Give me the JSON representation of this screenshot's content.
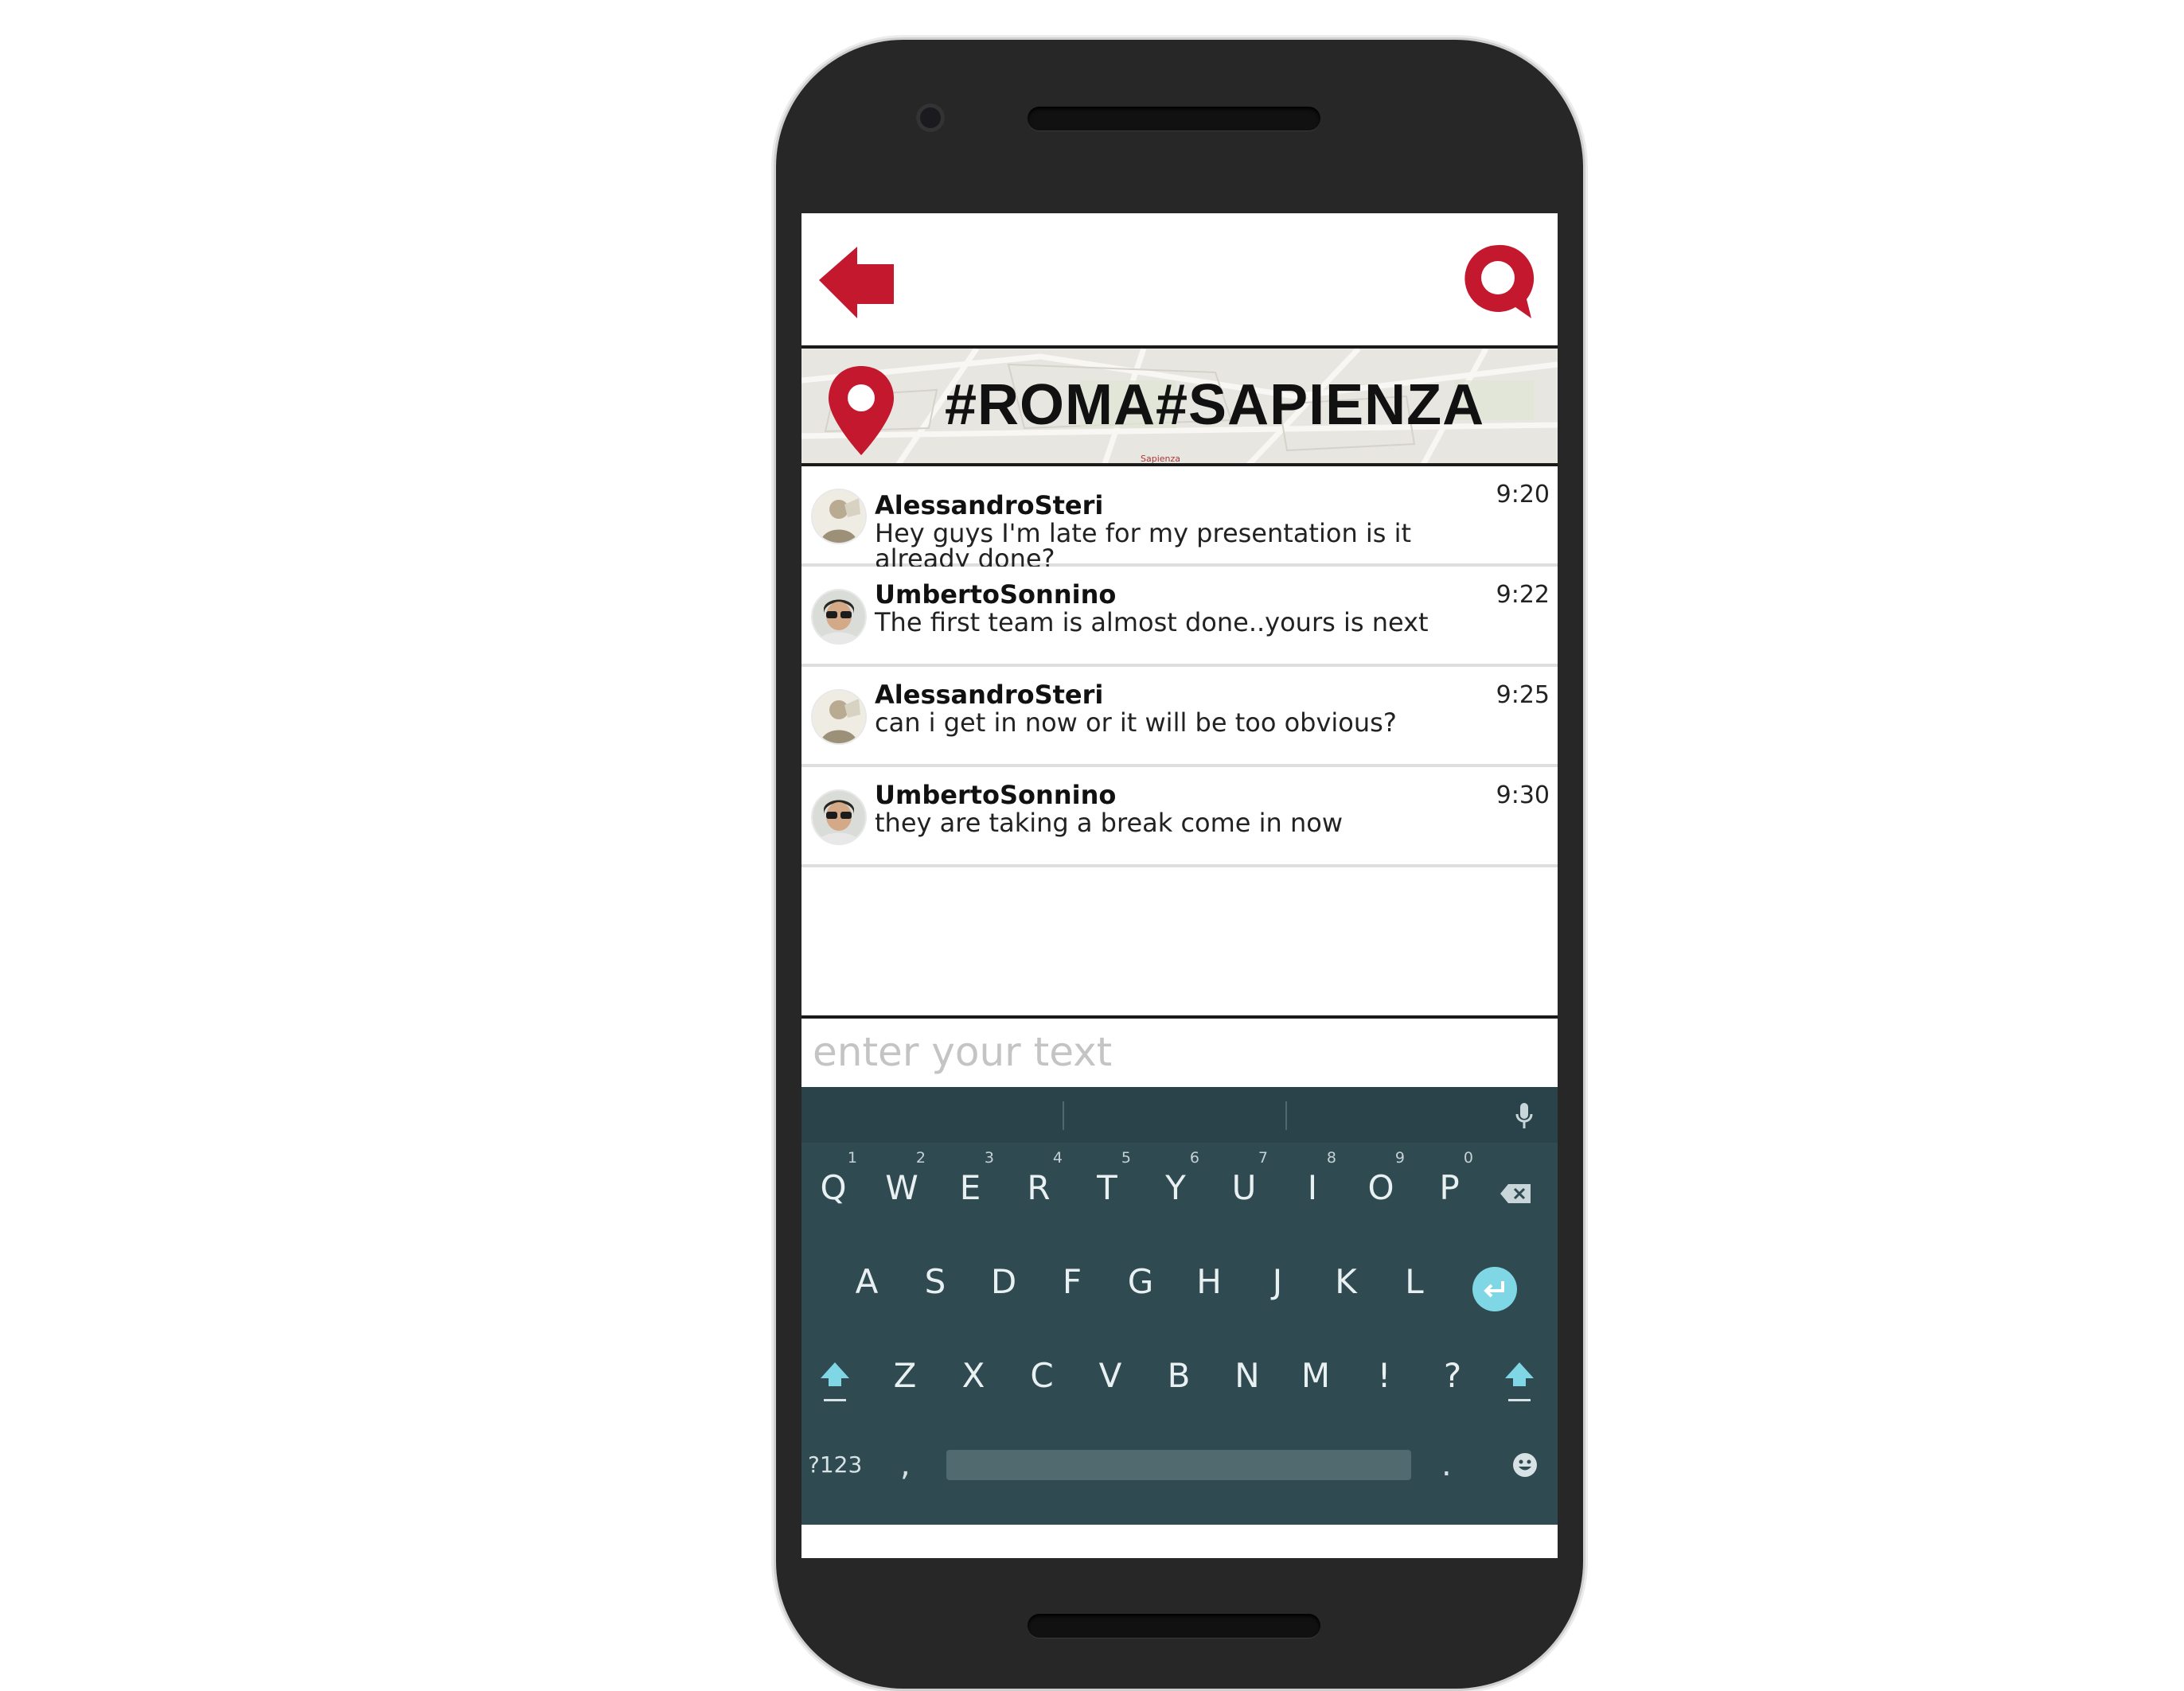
{
  "header": {
    "back_icon": "back-arrow-icon",
    "chat_icon": "chat-bubble-icon",
    "accent_color": "#c4182f"
  },
  "banner": {
    "pin_icon": "location-pin-icon",
    "title": "#ROMA#SAPIENZA",
    "map_label": "Sapienza"
  },
  "messages": [
    {
      "sender": "AlessandroSteri",
      "text": "Hey guys I'm late for my presentation is it already done?",
      "time": "9:20"
    },
    {
      "sender": "UmbertoSonnino",
      "text": "The first team is almost done..yours is next",
      "time": "9:22"
    },
    {
      "sender": "AlessandroSteri",
      "text": "can i get in now or it will be too obvious?",
      "time": "9:25"
    },
    {
      "sender": "UmbertoSonnino",
      "text": "they are taking a break come in now",
      "time": "9:30"
    }
  ],
  "composer": {
    "placeholder": "enter your text"
  },
  "keyboard": {
    "row1": [
      "Q",
      "W",
      "E",
      "R",
      "T",
      "Y",
      "U",
      "I",
      "O",
      "P"
    ],
    "row1_hints": [
      "1",
      "2",
      "3",
      "4",
      "5",
      "6",
      "7",
      "8",
      "9",
      "0"
    ],
    "row2": [
      "A",
      "S",
      "D",
      "F",
      "G",
      "H",
      "J",
      "K",
      "L"
    ],
    "row3": [
      "Z",
      "X",
      "C",
      "V",
      "B",
      "N",
      "M",
      "!",
      "?"
    ],
    "symbols_label": "?123",
    "comma": ",",
    "period": ".",
    "icons": [
      "backspace-icon",
      "enter-icon",
      "shift-icon",
      "mic-icon",
      "emoji-icon"
    ],
    "background_color": "#2f4a51",
    "enter_color": "#7fd6e4"
  }
}
